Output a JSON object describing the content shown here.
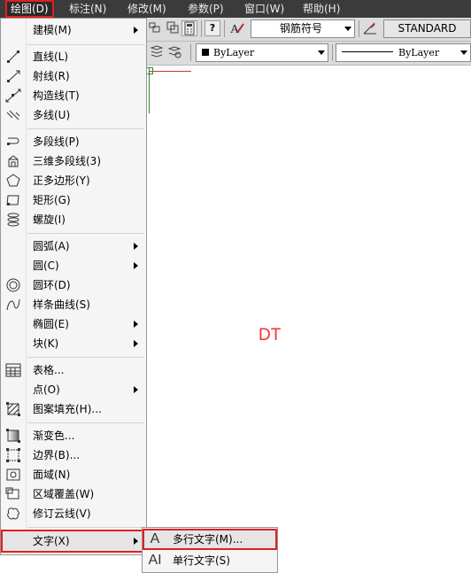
{
  "menubar": {
    "items": [
      {
        "label": "绘图(D)",
        "active": true
      },
      {
        "label": "标注(N)"
      },
      {
        "label": "修改(M)"
      },
      {
        "label": "参数(P)"
      },
      {
        "label": "窗口(W)"
      },
      {
        "label": "帮助(H)"
      }
    ]
  },
  "toolbar": {
    "text_style": "钢筋符号",
    "dim_style": "STANDARD",
    "help_glyph": "?",
    "color_combo": "ByLayer",
    "linetype_combo": "ByLayer"
  },
  "canvas": {
    "text": "DT",
    "text_color": "#ff2a2a"
  },
  "draw_menu": {
    "items": [
      {
        "label": "建模(M)",
        "icon": "none",
        "submenu": true
      },
      {
        "label": "直线(L)",
        "icon": "line-icon"
      },
      {
        "label": "射线(R)",
        "icon": "ray-icon"
      },
      {
        "label": "构造线(T)",
        "icon": "xline-icon"
      },
      {
        "label": "多线(U)",
        "icon": "mline-icon"
      },
      {
        "label": "多段线(P)",
        "icon": "polyline-icon"
      },
      {
        "label": "三维多段线(3)",
        "icon": "3d-polyline-icon"
      },
      {
        "label": "正多边形(Y)",
        "icon": "polygon-icon"
      },
      {
        "label": "矩形(G)",
        "icon": "rectangle-icon"
      },
      {
        "label": "螺旋(I)",
        "icon": "helix-icon"
      },
      {
        "label": "圆弧(A)",
        "icon": "none",
        "submenu": true
      },
      {
        "label": "圆(C)",
        "icon": "none",
        "submenu": true
      },
      {
        "label": "圆环(D)",
        "icon": "donut-icon"
      },
      {
        "label": "样条曲线(S)",
        "icon": "spline-icon"
      },
      {
        "label": "椭圆(E)",
        "icon": "none",
        "submenu": true
      },
      {
        "label": "块(K)",
        "icon": "none",
        "submenu": true
      },
      {
        "label": "表格...",
        "icon": "table-icon"
      },
      {
        "label": "点(O)",
        "icon": "none",
        "submenu": true
      },
      {
        "label": "图案填充(H)...",
        "icon": "hatch-icon"
      },
      {
        "label": "渐变色...",
        "icon": "gradient-icon"
      },
      {
        "label": "边界(B)...",
        "icon": "boundary-icon"
      },
      {
        "label": "面域(N)",
        "icon": "region-icon"
      },
      {
        "label": "区域覆盖(W)",
        "icon": "wipeout-icon"
      },
      {
        "label": "修订云线(V)",
        "icon": "revcloud-icon"
      },
      {
        "label": "文字(X)",
        "icon": "none",
        "submenu": true,
        "highlighted": true
      }
    ]
  },
  "text_submenu": {
    "items": [
      {
        "label": "多行文字(M)...",
        "icon": "mtext-icon",
        "glyph": "A",
        "highlighted": true
      },
      {
        "label": "单行文字(S)",
        "icon": "single-line-text-icon",
        "glyph": "AI"
      }
    ]
  },
  "colors": {
    "highlight_outline": "#e02020",
    "menubar_bg": "#3b3b3b",
    "menu_bg": "#f5f5f5"
  }
}
